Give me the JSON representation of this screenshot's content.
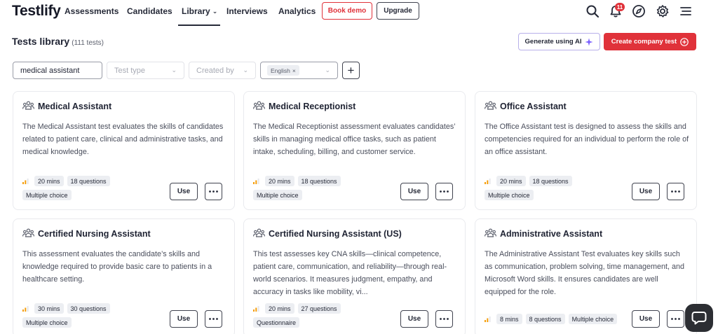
{
  "nav": {
    "logo": "Testlify",
    "links": [
      "Assessments",
      "Candidates",
      "Library",
      "Interviews",
      "Analytics"
    ],
    "book_demo": "Book demo",
    "upgrade": "Upgrade",
    "notification_count": "11",
    "icons": [
      "search-icon",
      "bell-icon",
      "compass-icon",
      "gear-icon",
      "menu-icon"
    ]
  },
  "header": {
    "title": "Tests library",
    "count": "(111 tests)",
    "generate_ai": "Generate using AI",
    "create_test": "Create company test"
  },
  "filters": {
    "search_value": "medical assistant",
    "test_type_placeholder": "Test type",
    "created_by_placeholder": "Created by",
    "language_chip": "English"
  },
  "cards": [
    {
      "title": "Medical Assistant",
      "description": "The Medical Assistant test evaluates the skills of candidates related to patient care, clinical and administrative tasks, and medical knowledge.",
      "duration": "20 mins",
      "questions": "18 questions",
      "type": "Multiple choice",
      "use": "Use"
    },
    {
      "title": "Medical Receptionist",
      "description": "The Medical Receptionist assessment evaluates candidates’ skills in managing medical office tasks, such as patient intake, scheduling, billing, and customer service.",
      "duration": "20 mins",
      "questions": "18 questions",
      "type": "Multiple choice",
      "use": "Use"
    },
    {
      "title": "Office Assistant",
      "description": "The Office Assistant test is designed to assess the skills and competencies required for an individual to perform the role of an office assistant.",
      "duration": "20 mins",
      "questions": "18 questions",
      "type": "Multiple choice",
      "use": "Use"
    },
    {
      "title": "Certified Nursing Assistant",
      "description": "This assessment evaluates the candidate’s skills and knowledge required to provide basic care to patients in a healthcare setting.",
      "duration": "30 mins",
      "questions": "30 questions",
      "type": "Multiple choice",
      "use": "Use"
    },
    {
      "title": "Certified Nursing Assistant (US)",
      "description": "This test assesses key CNA skills—clinical competence, patient care, communication, and reliability—through real-world scenarios. It measures judgment, empathy, and accuracy in tasks like mobility, vi...",
      "duration": "20 mins",
      "questions": "27 questions",
      "type": "Questionnaire",
      "use": "Use"
    },
    {
      "title": "Administrative Assistant",
      "description": "The Administrative Assistant Test evaluates key skills such as communication, problem solving, time management, and Microsoft Word skills. It ensures candidates are well equipped for the role.",
      "duration": "8 mins",
      "questions": "8 questions",
      "type": "Multiple choice",
      "use": "Use"
    }
  ],
  "colors": {
    "brand_red": "#e0323a",
    "ai_purple": "#7b61ff",
    "level_orange": "#f59e0b"
  }
}
